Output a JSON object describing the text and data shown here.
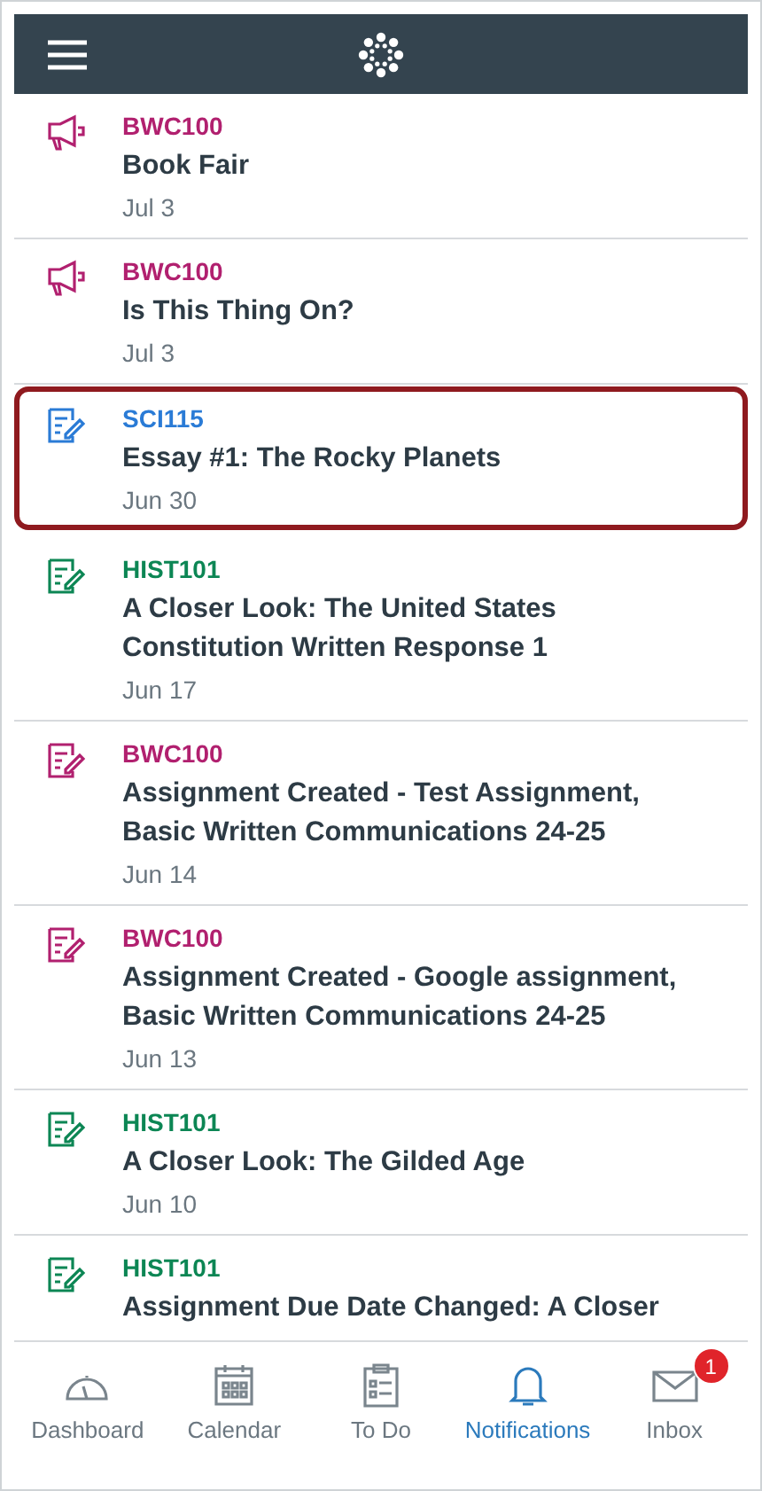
{
  "notifications": [
    {
      "kind": "announcement",
      "course": "BWC100",
      "color": "#b1206f",
      "title": "Book Fair",
      "date": "Jul 3",
      "selected": false
    },
    {
      "kind": "announcement",
      "course": "BWC100",
      "color": "#b1206f",
      "title": "Is This Thing On?",
      "date": "Jul 3",
      "selected": false
    },
    {
      "kind": "assignment",
      "course": "SCI115",
      "color": "#2a7bd6",
      "title": "Essay #1: The Rocky Planets",
      "date": "Jun 30",
      "selected": true
    },
    {
      "kind": "assignment",
      "course": "HIST101",
      "color": "#0c8654",
      "title": "A Closer Look: The United States Constitution Written Response 1",
      "date": "Jun 17",
      "selected": false
    },
    {
      "kind": "assignment",
      "course": "BWC100",
      "color": "#b1206f",
      "title": "Assignment Created - Test Assignment, Basic Written Communications 24-25",
      "date": "Jun 14",
      "selected": false
    },
    {
      "kind": "assignment",
      "course": "BWC100",
      "color": "#b1206f",
      "title": "Assignment Created - Google assignment, Basic Written Communications 24-25",
      "date": "Jun 13",
      "selected": false
    },
    {
      "kind": "assignment",
      "course": "HIST101",
      "color": "#0c8654",
      "title": "A Closer Look: The Gilded Age",
      "date": "Jun 10",
      "selected": false
    },
    {
      "kind": "assignment",
      "course": "HIST101",
      "color": "#0c8654",
      "title": "Assignment Due Date Changed: A Closer",
      "selected": false
    }
  ],
  "tabs": [
    {
      "kind": "dashboard",
      "label": "Dashboard",
      "selected": false
    },
    {
      "kind": "calendar",
      "label": "Calendar",
      "selected": false
    },
    {
      "kind": "todo",
      "label": "To Do",
      "selected": false
    },
    {
      "kind": "notifications",
      "label": "Notifications",
      "selected": true
    },
    {
      "kind": "inbox",
      "label": "Inbox",
      "selected": false,
      "badge": "1"
    }
  ]
}
